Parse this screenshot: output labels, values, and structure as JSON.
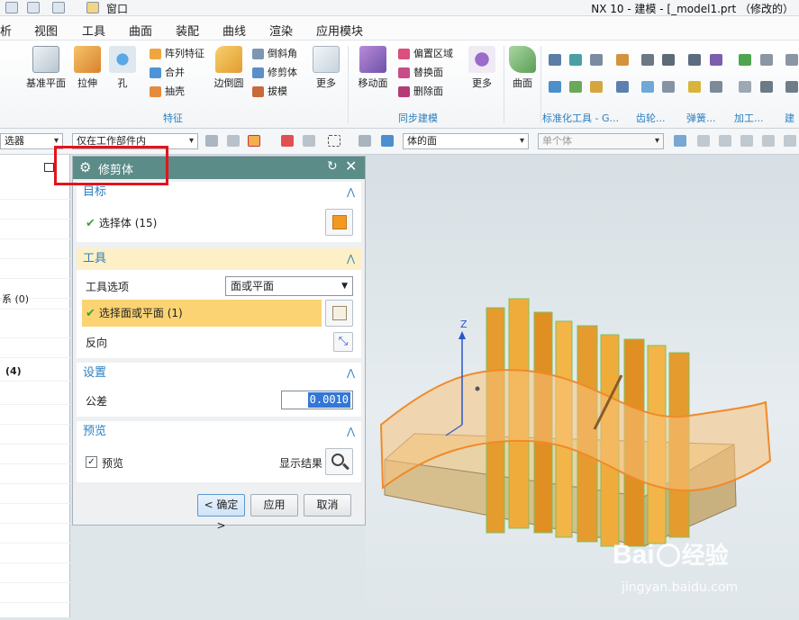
{
  "titlebar": {
    "window_menu": "窗口",
    "title": "NX 10 - 建模 - [_model1.prt （修改的）"
  },
  "menu": [
    "析",
    "视图",
    "工具",
    "曲面",
    "装配",
    "曲线",
    "渲染",
    "应用模块"
  ],
  "ribbon": {
    "datum_plane": "基准平面",
    "extrude": "拉伸",
    "hole": "孔",
    "pattern_feature": "阵列特征",
    "unite": "合并",
    "shell": "抽壳",
    "edge_blend": "边倒圆",
    "chamfer": "倒斜角",
    "trim_body": "修剪体",
    "draft": "拔模",
    "more1": "更多",
    "feature_group": "特征",
    "move_face": "移动面",
    "offset_region": "偏置区域",
    "replace_face": "替换面",
    "delete_face": "删除面",
    "more2": "更多",
    "sync_group": "同步建模",
    "surface": "曲面",
    "std_group": "标准化工具 - G...",
    "gear_group": "齿轮...",
    "spring_group": "弹簧...",
    "machining_group": "加工...",
    "construct_group": "建"
  },
  "toolbar": {
    "filter": "选器",
    "scope": "仅在工作部件内",
    "face_rule": "体的面",
    "body_rule": "单个体"
  },
  "left_panel": {
    "coord_sys": "系 (0)",
    "count": "(4)"
  },
  "dialog": {
    "title": "修剪体",
    "target": {
      "header": "目标",
      "select_body": "选择体 (15)"
    },
    "tool": {
      "header": "工具",
      "option_label": "工具选项",
      "option_value": "面或平面",
      "select_face": "选择面或平面 (1)",
      "reverse": "反向"
    },
    "settings": {
      "header": "设置",
      "tolerance_label": "公差",
      "tolerance_value": "0.0010"
    },
    "preview": {
      "header": "预览",
      "preview_label": "预览",
      "show_result": "显示结果"
    },
    "buttons": {
      "ok": "< 确定 >",
      "apply": "应用",
      "cancel": "取消"
    }
  },
  "viewport": {
    "axis_z": "Z"
  },
  "watermark": {
    "brand": "Bai",
    "brand2": "经验",
    "url": "jingyan.baidu.com"
  }
}
